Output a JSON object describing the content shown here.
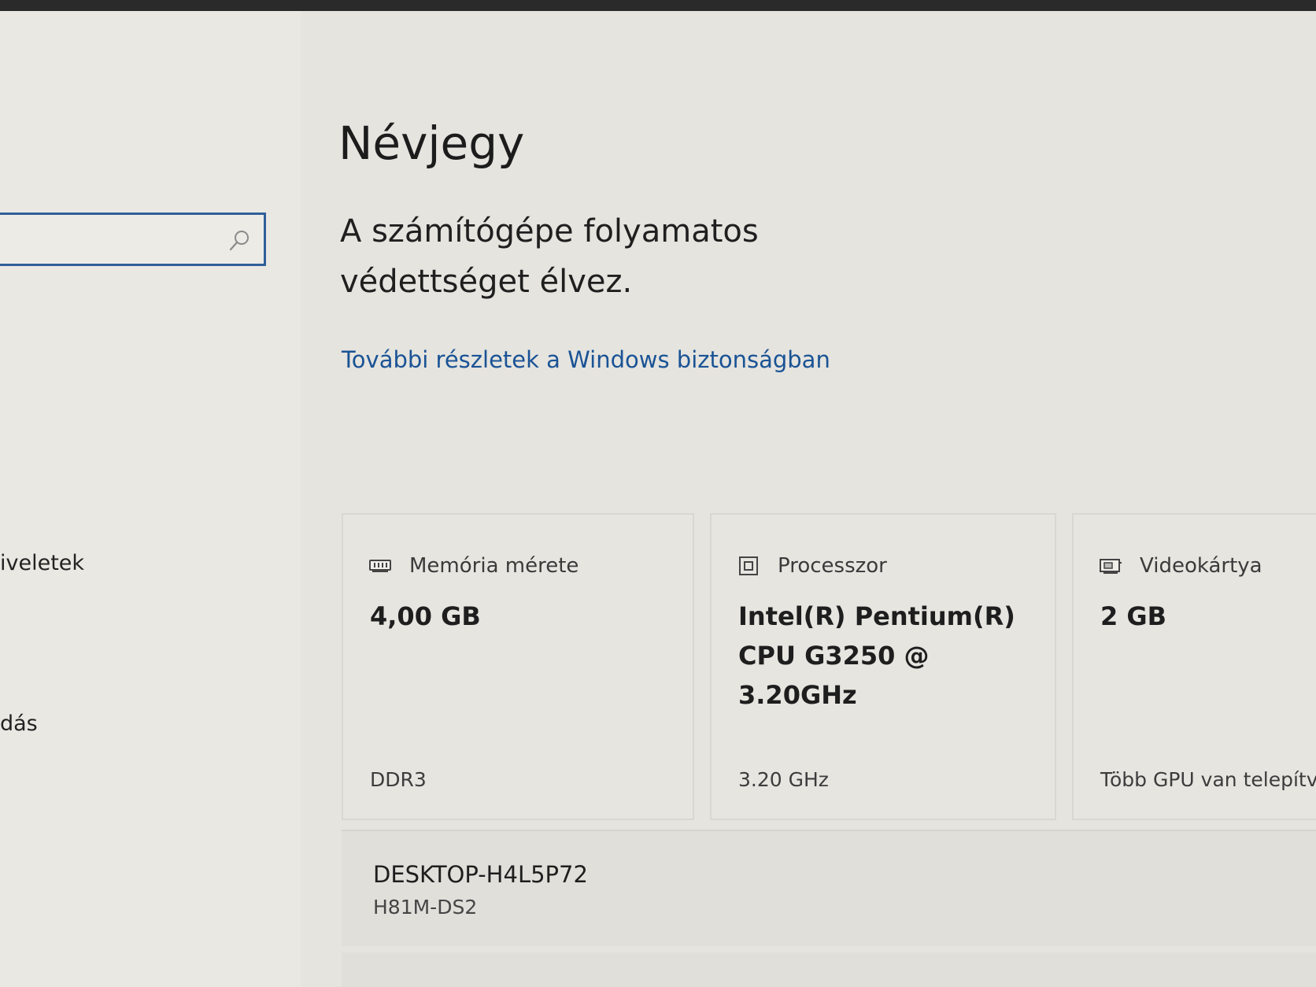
{
  "sidebar": {
    "search": {
      "value": "",
      "icon": "search-icon"
    },
    "items": [
      {
        "label": "iveletek"
      },
      {
        "label": "dás"
      }
    ]
  },
  "about": {
    "title": "Névjegy",
    "protection_text": "A számítógépe folyamatos védettséget élvez.",
    "security_link": "További részletek a Windows biztonságban",
    "link_color": "#1a5395"
  },
  "specs": {
    "memory": {
      "icon": "memory-icon",
      "label": "Memória mérete",
      "value": "4,00 GB",
      "detail": "DDR3"
    },
    "processor": {
      "icon": "processor-icon",
      "label": "Processzor",
      "value": "Intel(R) Pentium(R) CPU G3250 @ 3.20GHz",
      "detail": "3.20 GHz"
    },
    "gpu": {
      "icon": "gpu-icon",
      "label": "Videokártya",
      "value": "2 GB",
      "detail": "Több GPU van telepítv"
    }
  },
  "device": {
    "name": "DESKTOP-H4L5P72",
    "model": "H81M-DS2"
  }
}
